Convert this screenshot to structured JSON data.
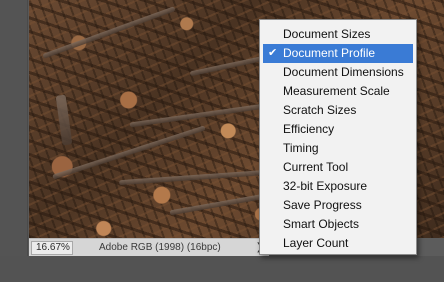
{
  "status_bar": {
    "zoom": "16.67%",
    "document_info": "Adobe RGB (1998) (16bpc)",
    "arrow_icon": "chevron-right-icon"
  },
  "menu": {
    "items": [
      {
        "label": "Document Sizes",
        "checked": false
      },
      {
        "label": "Document Profile",
        "checked": true
      },
      {
        "label": "Document Dimensions",
        "checked": false
      },
      {
        "label": "Measurement Scale",
        "checked": false
      },
      {
        "label": "Scratch Sizes",
        "checked": false
      },
      {
        "label": "Efficiency",
        "checked": false
      },
      {
        "label": "Timing",
        "checked": false
      },
      {
        "label": "Current Tool",
        "checked": false
      },
      {
        "label": "32-bit Exposure",
        "checked": false
      },
      {
        "label": "Save Progress",
        "checked": false
      },
      {
        "label": "Smart Objects",
        "checked": false
      },
      {
        "label": "Layer Count",
        "checked": false
      }
    ],
    "check_glyph": "✔"
  },
  "colors": {
    "selection": "#3a7bd5",
    "menu_background": "#f2f2f2",
    "workspace": "#595959"
  }
}
